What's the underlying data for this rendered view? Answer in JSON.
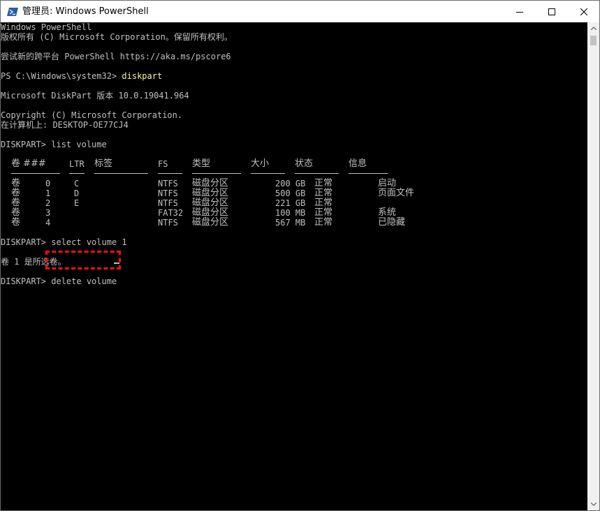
{
  "window": {
    "title": "管理员: Windows PowerShell"
  },
  "console": {
    "lines": [
      "Windows PowerShell",
      "版权所有 (C) Microsoft Corporation。保留所有权利。",
      "尝试新的跨平台 PowerShell https://aka.ms/pscore6",
      "PS C:\\Windows\\system32> ",
      "diskpart",
      "Microsoft DiskPart 版本 10.0.19041.964",
      "Copyright (C) Microsoft Corporation.",
      "在计算机上: DESKTOP-OE77CJ4",
      "DISKPART> list volume",
      "DISKPART> select volume 1",
      "卷 1 是所选卷。",
      "DISKPART> ",
      "delete volume"
    ],
    "volume_table": {
      "headers": [
        "卷 ###",
        "LTR",
        "标签",
        "FS",
        "类型",
        "大小",
        "状态",
        "信息"
      ],
      "rows": [
        [
          "卷",
          "0",
          "C",
          "NTFS",
          "磁盘分区",
          "200 GB",
          "正常",
          "启动"
        ],
        [
          "卷",
          "1",
          "D",
          "NTFS",
          "磁盘分区",
          "500 GB",
          "正常",
          "页面文件"
        ],
        [
          "卷",
          "2",
          "E",
          "NTFS",
          "磁盘分区",
          "221 GB",
          "正常",
          ""
        ],
        [
          "卷",
          "3",
          "",
          "FAT32",
          "磁盘分区",
          "100 MB",
          "正常",
          "系统"
        ],
        [
          "卷",
          "4",
          "",
          "NTFS",
          "磁盘分区",
          "567 MB",
          "正常",
          "已隐藏"
        ]
      ]
    }
  },
  "colors": {
    "background": "#000000",
    "text": "#c0c0c0",
    "command": "#f5f5a0",
    "highlight": "#ff1010"
  },
  "icons": {
    "app": "powershell-icon",
    "minimize": "minimize-icon",
    "maximize": "maximize-icon",
    "close": "close-icon"
  }
}
